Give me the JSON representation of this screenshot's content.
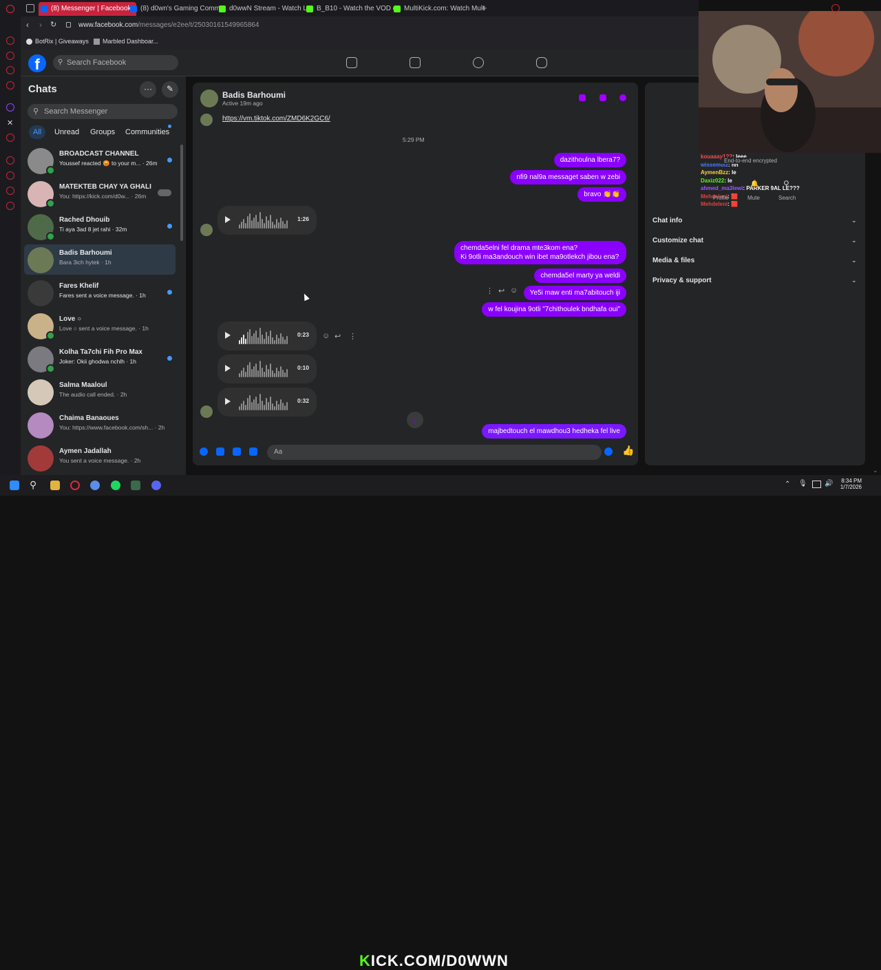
{
  "browser": {
    "tabs": [
      {
        "label": "(8) Messenger | Facebook",
        "active": true
      },
      {
        "label": "(8) d0wn's Gaming Comm"
      },
      {
        "label": "d0wwN Stream - Watch L"
      },
      {
        "label": "B_B10 - Watch the VOD o"
      },
      {
        "label": "MultiKick.com: Watch Mult"
      }
    ],
    "address_domain": "www.facebook.com",
    "address_path": "/messages/e2ee/t/25030161549965864",
    "bookmarks": [
      "BotRix | Giveaways",
      "Marbled Dashboar..."
    ]
  },
  "fb": {
    "search_placeholder": "Search Facebook"
  },
  "left": {
    "title": "Chats",
    "search_placeholder": "Search Messenger",
    "filters": [
      "All",
      "Unread",
      "Groups",
      "Communities"
    ],
    "chats": [
      {
        "name": "BROADCAST CHANNEL",
        "preview": "Youssef reacted 😡 to your m... · 26m",
        "unread": true,
        "online": true
      },
      {
        "name": "MATEKTEB CHAY YA GHALI",
        "preview": "You: https://kick.com/d0w... · 26m",
        "unread": false,
        "online": true
      },
      {
        "name": "Rached Dhouib",
        "preview": "Ti aya 3ad 8 jet rahi · 32m",
        "unread": true,
        "online": true
      },
      {
        "name": "Badis Barhoumi",
        "preview": "Bara 3ich hytek · 1h",
        "unread": false,
        "online": false,
        "selected": true
      },
      {
        "name": "Fares Khelif",
        "preview": "Fares sent a voice message. · 1h",
        "unread": true,
        "online": false
      },
      {
        "name": "Love ○",
        "preview": "Love ○ sent a voice message. · 1h",
        "unread": false,
        "online": true
      },
      {
        "name": "Kolha Ta7chi Fih Pro Max",
        "preview": "Joker: Okii ghodwa nchlh · 1h",
        "unread": true,
        "online": true
      },
      {
        "name": "Salma Maaloul",
        "preview": "The audio call ended. · 2h",
        "unread": false,
        "online": false
      },
      {
        "name": "Chaima Banaoues",
        "preview": "You: https://www.facebook.com/sh... · 2h",
        "unread": false,
        "online": false
      },
      {
        "name": "Aymen Jadallah",
        "preview": "You sent a voice message. · 2h",
        "unread": false,
        "online": false
      }
    ]
  },
  "conv": {
    "name": "Badis Barhoumi",
    "status": "Active 19m ago",
    "link": "https://vm.tiktok.com/ZMD6K2GC6/",
    "time": "5:29 PM",
    "out1": "dazithoulna lbera7?",
    "out2": "nfi9 nal9a messaget saben w zebi",
    "out3": "bravo 👏👏",
    "voice1": "1:26",
    "out4a": "chemda5elni fel drama mte3kom ena?",
    "out4b": "Ki 9otli ma3andouch win ibet ma9otlekch jibou ena?",
    "out5": "chemda5el marty ya weldi",
    "out6": "Ye5i maw enti ma7abitouch iji",
    "out7": "w fel koujina 9otli \"7chithoulek bndhafa oui\"",
    "voice2": "0:23",
    "voice3": "0:10",
    "voice4": "0:32",
    "out8": "majbedtouch el mawdhou3 hedheka fel live",
    "input_placeholder": "Aa"
  },
  "right": {
    "encrypted": "End-to-end encrypted",
    "actions": [
      "Profile",
      "Mute",
      "Search"
    ],
    "items": [
      "Chat info",
      "Customize chat",
      "Media & files",
      "Privacy & support"
    ]
  },
  "stream_chat": [
    {
      "user": "kouaaay1??",
      "msg": "leee",
      "color": "#ff4b4b"
    },
    {
      "user": "wissemdiz",
      "msg": "nn",
      "color": "#4b7bff"
    },
    {
      "user": "AymenBzz",
      "msg": "le",
      "color": "#ffd23f"
    },
    {
      "user": "Daxiz022",
      "msg": "le",
      "color": "#53fc18"
    },
    {
      "user": "ahmed_ma3lewi",
      "msg": "PARKER 9AL LE???",
      "color": "#9b59ff"
    },
    {
      "user": "Mehdeleni",
      "msg": "🟥",
      "color": "#e04040"
    },
    {
      "user": "Mehdeleni",
      "msg": "🟥",
      "color": "#e04040"
    }
  ],
  "taskbar": {
    "banner_k": "K",
    "banner_rest": "ICK.COM/D0WWN",
    "time": "8:34 PM",
    "date": "1/7/2026"
  }
}
